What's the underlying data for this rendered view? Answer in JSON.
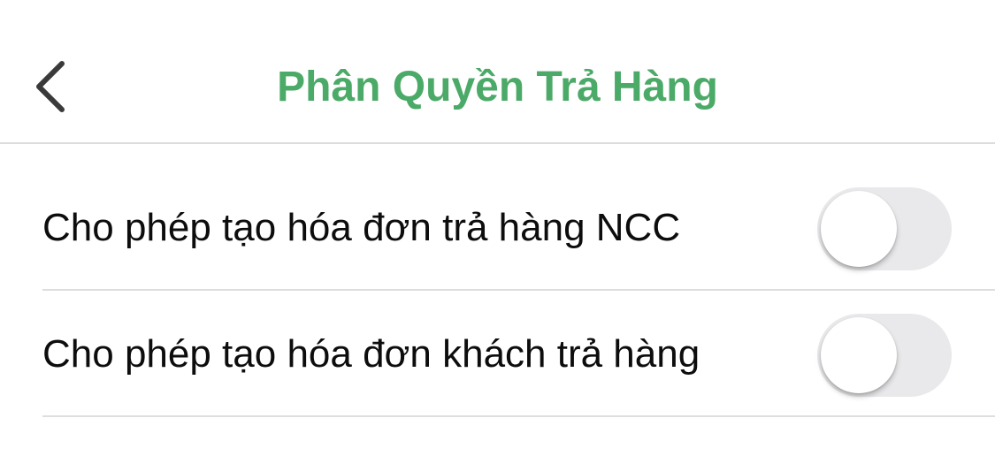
{
  "header": {
    "title": "Phân Quyền Trả Hàng",
    "back_icon": "chevron-left-icon",
    "title_color": "#4caa68"
  },
  "settings": [
    {
      "label": "Cho phép tạo hóa đơn trả hàng NCC",
      "enabled": false
    },
    {
      "label": "Cho phép tạo hóa đơn khách trả hàng",
      "enabled": false
    }
  ],
  "colors": {
    "toggle_off_track": "#e9e9eb",
    "divider": "#dedede"
  }
}
